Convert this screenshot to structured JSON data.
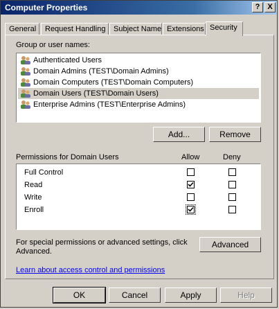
{
  "window": {
    "title": "Computer Properties",
    "help_glyph": "?",
    "close_glyph": "X"
  },
  "tabs": [
    {
      "label": "General"
    },
    {
      "label": "Request Handling"
    },
    {
      "label": "Subject Name"
    },
    {
      "label": "Extensions"
    },
    {
      "label": "Security",
      "active": true
    }
  ],
  "groups": {
    "label": "Group or user names:",
    "items": [
      {
        "name": "Authenticated Users",
        "icon": "users-icon",
        "selected": false
      },
      {
        "name": "Domain Admins (TEST\\Domain Admins)",
        "icon": "users-icon",
        "selected": false
      },
      {
        "name": "Domain Computers (TEST\\Domain Computers)",
        "icon": "users-icon",
        "selected": false
      },
      {
        "name": "Domain Users (TEST\\Domain Users)",
        "icon": "users-icon",
        "selected": true
      },
      {
        "name": "Enterprise Admins (TEST\\Enterprise Admins)",
        "icon": "users-icon",
        "selected": false
      }
    ],
    "add_label": "Add...",
    "remove_label": "Remove"
  },
  "permissions": {
    "label": "Permissions for Domain Users",
    "allow_header": "Allow",
    "deny_header": "Deny",
    "rows": [
      {
        "name": "Full Control",
        "allow": false,
        "deny": false
      },
      {
        "name": "Read",
        "allow": true,
        "deny": false
      },
      {
        "name": "Write",
        "allow": false,
        "deny": false
      },
      {
        "name": "Enroll",
        "allow": true,
        "deny": false
      }
    ]
  },
  "advanced": {
    "text_line1": "For special permissions or advanced settings, click",
    "text_line2": "Advanced.",
    "button_label": "Advanced"
  },
  "link_text": "Learn about access control and permissions",
  "footer": {
    "ok_label": "OK",
    "cancel_label": "Cancel",
    "apply_label": "Apply",
    "help_label": "Help",
    "help_disabled": true
  }
}
